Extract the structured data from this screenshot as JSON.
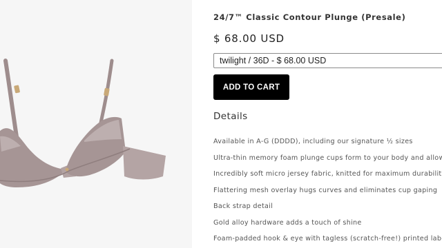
{
  "product": {
    "title": "24/7™ Classic Contour Plunge (Presale)",
    "price": "$ 68.00 USD",
    "image": {
      "description": "bra",
      "color": "#a69595"
    }
  },
  "variant": {
    "selected": "twilight / 36D - $ 68.00 USD"
  },
  "cart": {
    "add_label": "ADD TO CART"
  },
  "details": {
    "heading": "Details",
    "features": [
      "Available in A-G (DDDD), including our signature ½ sizes",
      "Ultra-thin memory foam plunge cups form to your body and allow for a",
      "Incredibly soft micro jersey fabric, knitted for maximum durability",
      "Flattering mesh overlay hugs curves and eliminates cup gaping",
      "Back strap detail",
      "Gold alloy hardware adds a touch of shine",
      "Foam-padded hook & eye with tagless (scratch-free!) printed label"
    ]
  }
}
